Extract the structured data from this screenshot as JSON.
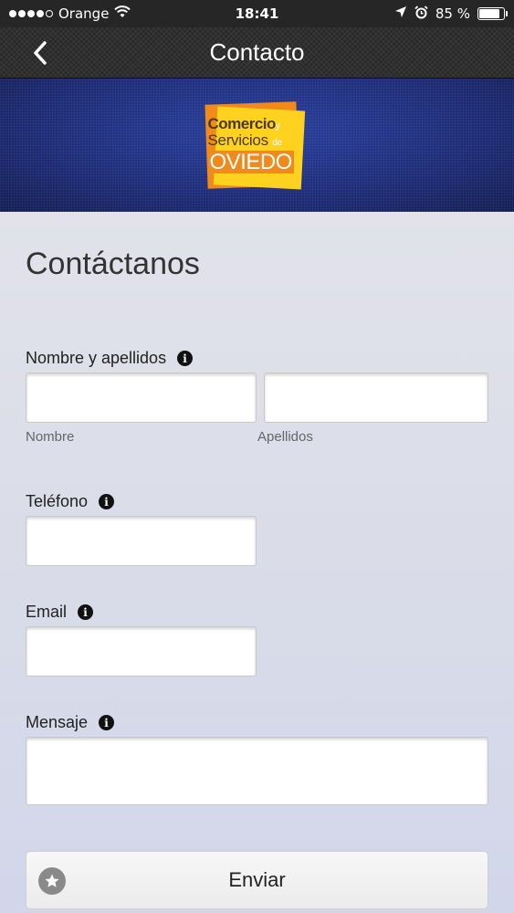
{
  "status_bar": {
    "carrier": "Orange",
    "time": "18:41",
    "battery_percent": "85 %",
    "battery_level": 0.85,
    "icons": [
      "signal-dots-icon",
      "wifi-icon",
      "location-arrow-icon",
      "alarm-icon",
      "battery-icon"
    ]
  },
  "nav": {
    "title": "Contacto",
    "back_icon": "chevron-left-icon"
  },
  "banner": {
    "logo": {
      "line1": "Comercio",
      "line1_suffix": "y",
      "line2": "Servicios",
      "line2_suffix": "de",
      "line3": "OVIEDO"
    }
  },
  "form": {
    "title": "Contáctanos",
    "name_label": "Nombre y apellidos",
    "first_name_sublabel": "Nombre",
    "last_name_sublabel": "Apellidos",
    "phone_label": "Teléfono",
    "email_label": "Email",
    "message_label": "Mensaje",
    "submit_label": "Enviar",
    "info_glyph": "i"
  },
  "colors": {
    "status_bar_bg": "#262626",
    "nav_bg": "#2b2b2b",
    "banner_blue": "#1e2d7a",
    "content_bg": "#d9dce8",
    "logo_orange": "#f08a1a",
    "logo_yellow": "#ffd21f"
  }
}
